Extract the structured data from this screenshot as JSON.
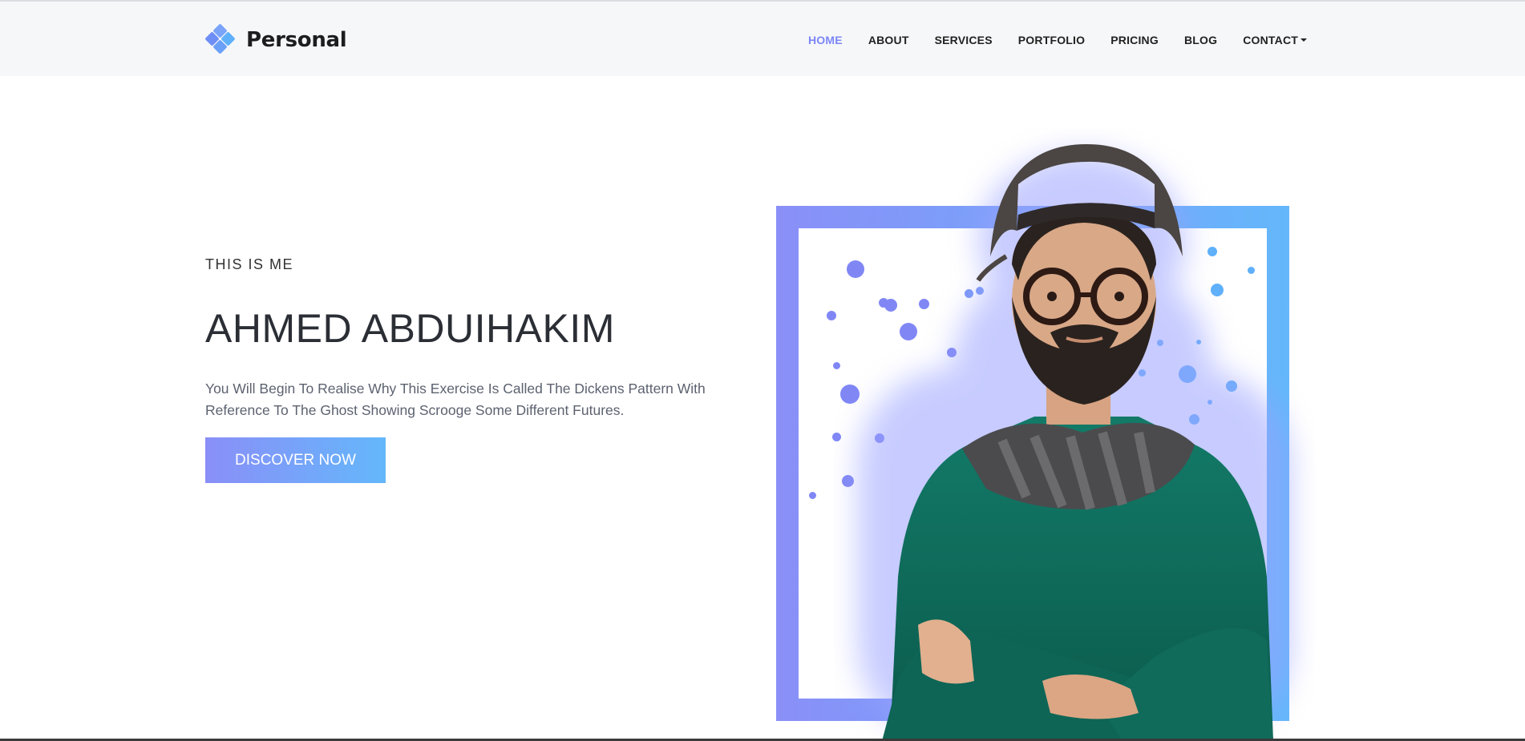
{
  "brand": {
    "name": "Personal",
    "icon": "diamond-cluster-icon",
    "colors": [
      "#7c87f5",
      "#5fb0fa"
    ]
  },
  "nav": {
    "items": [
      {
        "label": "HOME",
        "active": true
      },
      {
        "label": "ABOUT"
      },
      {
        "label": "SERVICES"
      },
      {
        "label": "PORTFOLIO"
      },
      {
        "label": "PRICING"
      },
      {
        "label": "BLOG"
      },
      {
        "label": "CONTACT",
        "dropdown": true
      }
    ]
  },
  "hero": {
    "eyebrow": "THIS IS ME",
    "title": "AHMED ABDUIHAKIM",
    "description": "You Will Begin To Realise Why This Exercise Is Called The Dickens Pattern With Reference To The Ghost Showing Scrooge Some Different Futures.",
    "cta_label": "DISCOVER NOW"
  },
  "colors": {
    "accent": "#7c87f5",
    "gradient_start": "#8a8ff8",
    "gradient_end": "#64b7fb",
    "header_bg": "#f6f7f9",
    "sweater": "#0f6a5a"
  }
}
